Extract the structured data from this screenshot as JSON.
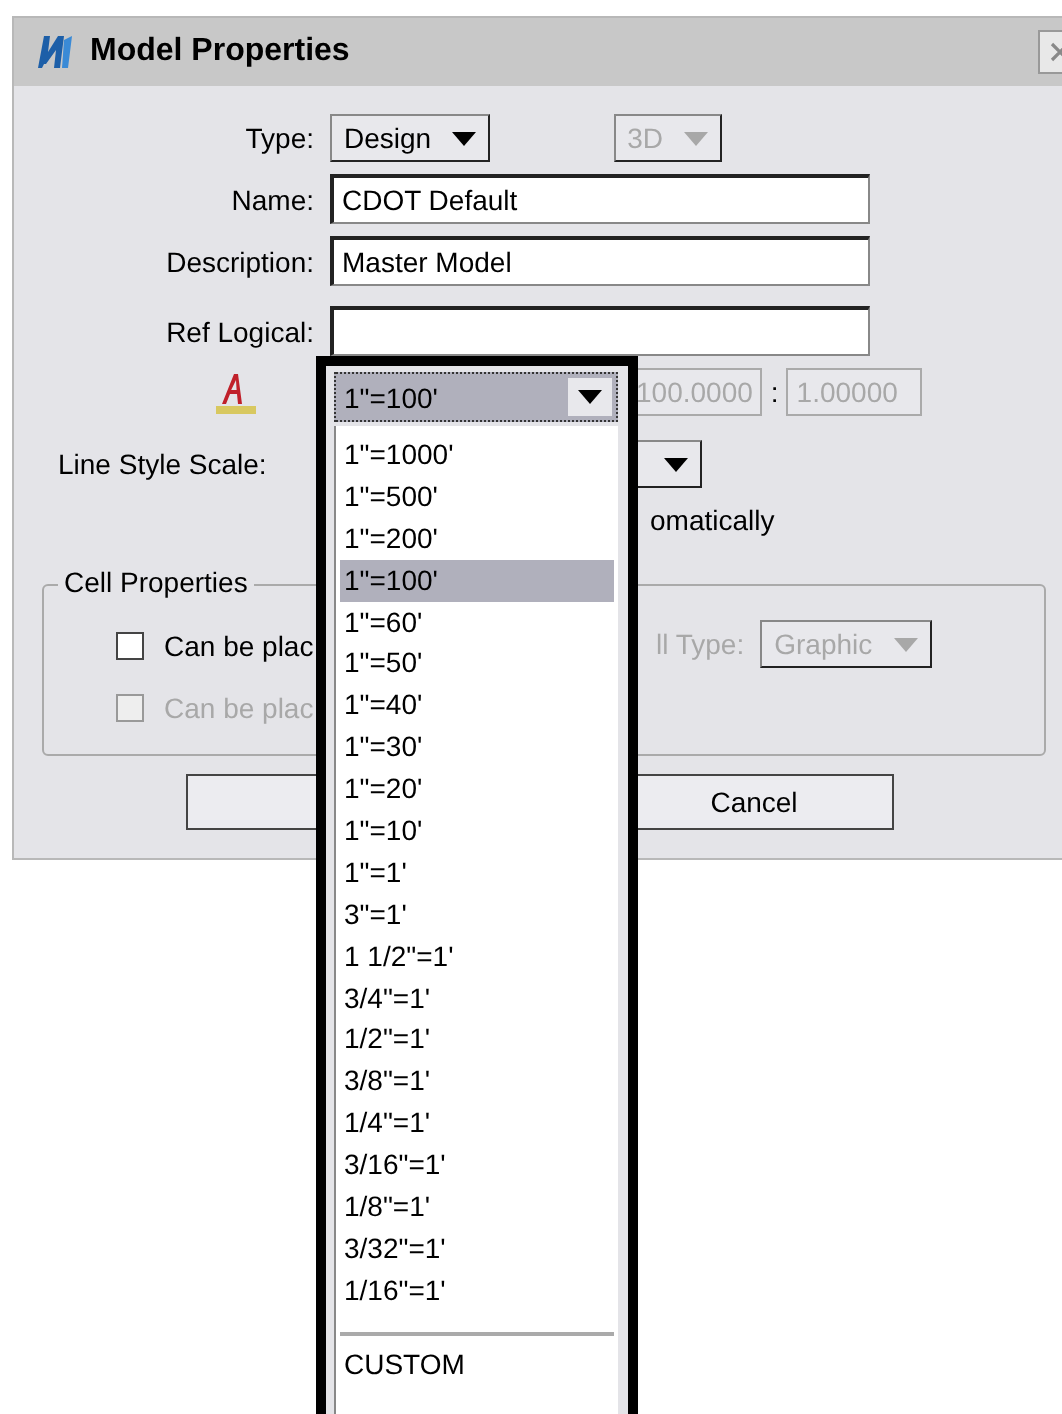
{
  "window": {
    "title": "Model Properties"
  },
  "type": {
    "label": "Type:",
    "value": "Design"
  },
  "dimension": {
    "value": "3D",
    "disabled": true
  },
  "name": {
    "label": "Name:",
    "value": "CDOT Default"
  },
  "description": {
    "label": "Description:",
    "value": "Master Model"
  },
  "ref_logical": {
    "label": "Ref Logical:"
  },
  "annotation_scale": {
    "value_1": "100.0000",
    "separator": ":",
    "value_2": "1.00000",
    "disabled": true
  },
  "line_style_scale": {
    "label": "Line Style Scale:",
    "partial_text": "omatically"
  },
  "cell_properties": {
    "title": "Cell Properties",
    "checkboxes": [
      {
        "label": "Can be plac",
        "checked": false,
        "disabled": false
      },
      {
        "label": "Can be plac",
        "checked": false,
        "disabled": true
      }
    ],
    "cell_type": {
      "label": "ll Type:",
      "value": "Graphic",
      "disabled": true
    }
  },
  "buttons": [
    {
      "kind": "covered"
    },
    {
      "kind": "text",
      "label": "Cancel"
    }
  ],
  "dropdown": {
    "value": "1\"=100'",
    "items": [
      {
        "label": "1\"=1000'",
        "selected": false
      },
      {
        "label": "1\"=500'",
        "selected": false
      },
      {
        "label": "1\"=200'",
        "selected": false
      },
      {
        "label": "1\"=100'",
        "selected": true
      },
      {
        "label": "1\"=60'",
        "selected": false
      },
      {
        "label": "1\"=50'",
        "selected": false
      },
      {
        "label": "1\"=40'",
        "selected": false
      },
      {
        "label": "1\"=30'",
        "selected": false
      },
      {
        "label": "1\"=20'",
        "selected": false
      },
      {
        "label": "1\"=10'",
        "selected": false
      },
      {
        "label": "1\"=1'",
        "selected": false
      },
      {
        "label": "3\"=1'",
        "selected": false
      },
      {
        "label": "1 1/2\"=1'",
        "selected": false
      },
      {
        "label": "3/4\"=1'",
        "selected": false
      },
      {
        "label": "1/2\"=1'",
        "selected": false
      },
      {
        "label": "3/8\"=1'",
        "selected": false
      },
      {
        "label": "1/4\"=1'",
        "selected": false
      },
      {
        "label": "3/16\"=1'",
        "selected": false
      },
      {
        "label": "1/8\"=1'",
        "selected": false
      },
      {
        "label": "3/32\"=1'",
        "selected": false
      },
      {
        "label": "1/16\"=1'",
        "selected": false
      }
    ],
    "custom": "CUSTOM"
  }
}
